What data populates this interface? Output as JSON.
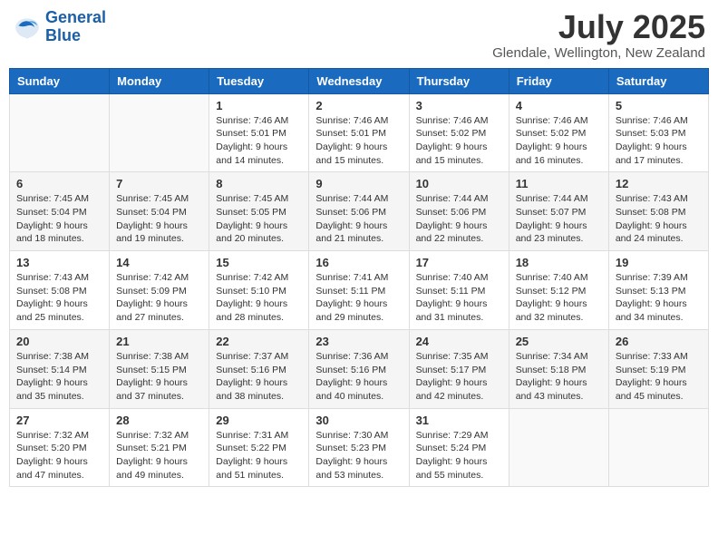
{
  "logo": {
    "line1": "General",
    "line2": "Blue"
  },
  "title": "July 2025",
  "location": "Glendale, Wellington, New Zealand",
  "weekdays": [
    "Sunday",
    "Monday",
    "Tuesday",
    "Wednesday",
    "Thursday",
    "Friday",
    "Saturday"
  ],
  "weeks": [
    [
      {
        "day": "",
        "info": ""
      },
      {
        "day": "",
        "info": ""
      },
      {
        "day": "1",
        "info": "Sunrise: 7:46 AM\nSunset: 5:01 PM\nDaylight: 9 hours\nand 14 minutes."
      },
      {
        "day": "2",
        "info": "Sunrise: 7:46 AM\nSunset: 5:01 PM\nDaylight: 9 hours\nand 15 minutes."
      },
      {
        "day": "3",
        "info": "Sunrise: 7:46 AM\nSunset: 5:02 PM\nDaylight: 9 hours\nand 15 minutes."
      },
      {
        "day": "4",
        "info": "Sunrise: 7:46 AM\nSunset: 5:02 PM\nDaylight: 9 hours\nand 16 minutes."
      },
      {
        "day": "5",
        "info": "Sunrise: 7:46 AM\nSunset: 5:03 PM\nDaylight: 9 hours\nand 17 minutes."
      }
    ],
    [
      {
        "day": "6",
        "info": "Sunrise: 7:45 AM\nSunset: 5:04 PM\nDaylight: 9 hours\nand 18 minutes."
      },
      {
        "day": "7",
        "info": "Sunrise: 7:45 AM\nSunset: 5:04 PM\nDaylight: 9 hours\nand 19 minutes."
      },
      {
        "day": "8",
        "info": "Sunrise: 7:45 AM\nSunset: 5:05 PM\nDaylight: 9 hours\nand 20 minutes."
      },
      {
        "day": "9",
        "info": "Sunrise: 7:44 AM\nSunset: 5:06 PM\nDaylight: 9 hours\nand 21 minutes."
      },
      {
        "day": "10",
        "info": "Sunrise: 7:44 AM\nSunset: 5:06 PM\nDaylight: 9 hours\nand 22 minutes."
      },
      {
        "day": "11",
        "info": "Sunrise: 7:44 AM\nSunset: 5:07 PM\nDaylight: 9 hours\nand 23 minutes."
      },
      {
        "day": "12",
        "info": "Sunrise: 7:43 AM\nSunset: 5:08 PM\nDaylight: 9 hours\nand 24 minutes."
      }
    ],
    [
      {
        "day": "13",
        "info": "Sunrise: 7:43 AM\nSunset: 5:08 PM\nDaylight: 9 hours\nand 25 minutes."
      },
      {
        "day": "14",
        "info": "Sunrise: 7:42 AM\nSunset: 5:09 PM\nDaylight: 9 hours\nand 27 minutes."
      },
      {
        "day": "15",
        "info": "Sunrise: 7:42 AM\nSunset: 5:10 PM\nDaylight: 9 hours\nand 28 minutes."
      },
      {
        "day": "16",
        "info": "Sunrise: 7:41 AM\nSunset: 5:11 PM\nDaylight: 9 hours\nand 29 minutes."
      },
      {
        "day": "17",
        "info": "Sunrise: 7:40 AM\nSunset: 5:11 PM\nDaylight: 9 hours\nand 31 minutes."
      },
      {
        "day": "18",
        "info": "Sunrise: 7:40 AM\nSunset: 5:12 PM\nDaylight: 9 hours\nand 32 minutes."
      },
      {
        "day": "19",
        "info": "Sunrise: 7:39 AM\nSunset: 5:13 PM\nDaylight: 9 hours\nand 34 minutes."
      }
    ],
    [
      {
        "day": "20",
        "info": "Sunrise: 7:38 AM\nSunset: 5:14 PM\nDaylight: 9 hours\nand 35 minutes."
      },
      {
        "day": "21",
        "info": "Sunrise: 7:38 AM\nSunset: 5:15 PM\nDaylight: 9 hours\nand 37 minutes."
      },
      {
        "day": "22",
        "info": "Sunrise: 7:37 AM\nSunset: 5:16 PM\nDaylight: 9 hours\nand 38 minutes."
      },
      {
        "day": "23",
        "info": "Sunrise: 7:36 AM\nSunset: 5:16 PM\nDaylight: 9 hours\nand 40 minutes."
      },
      {
        "day": "24",
        "info": "Sunrise: 7:35 AM\nSunset: 5:17 PM\nDaylight: 9 hours\nand 42 minutes."
      },
      {
        "day": "25",
        "info": "Sunrise: 7:34 AM\nSunset: 5:18 PM\nDaylight: 9 hours\nand 43 minutes."
      },
      {
        "day": "26",
        "info": "Sunrise: 7:33 AM\nSunset: 5:19 PM\nDaylight: 9 hours\nand 45 minutes."
      }
    ],
    [
      {
        "day": "27",
        "info": "Sunrise: 7:32 AM\nSunset: 5:20 PM\nDaylight: 9 hours\nand 47 minutes."
      },
      {
        "day": "28",
        "info": "Sunrise: 7:32 AM\nSunset: 5:21 PM\nDaylight: 9 hours\nand 49 minutes."
      },
      {
        "day": "29",
        "info": "Sunrise: 7:31 AM\nSunset: 5:22 PM\nDaylight: 9 hours\nand 51 minutes."
      },
      {
        "day": "30",
        "info": "Sunrise: 7:30 AM\nSunset: 5:23 PM\nDaylight: 9 hours\nand 53 minutes."
      },
      {
        "day": "31",
        "info": "Sunrise: 7:29 AM\nSunset: 5:24 PM\nDaylight: 9 hours\nand 55 minutes."
      },
      {
        "day": "",
        "info": ""
      },
      {
        "day": "",
        "info": ""
      }
    ]
  ]
}
